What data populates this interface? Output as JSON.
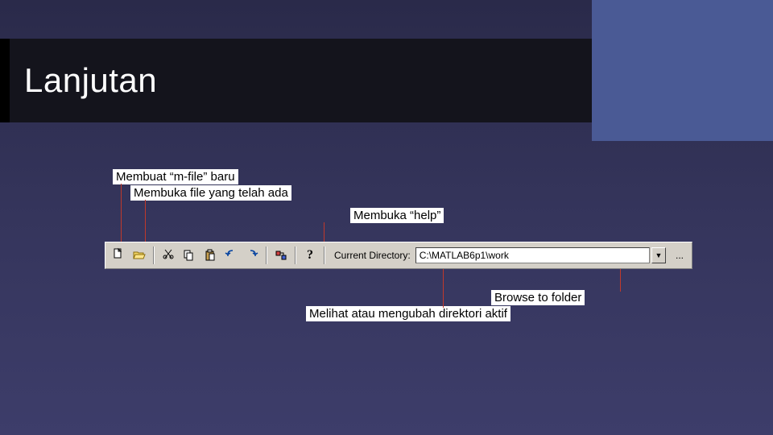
{
  "title": "Lanjutan",
  "annotations": {
    "new_mfile": "Membuat “m-file” baru",
    "open_file": "Membuka file yang telah ada",
    "open_help": "Membuka “help”",
    "browse_folder": "Browse to folder",
    "change_dir": "Melihat atau mengubah direktori aktif"
  },
  "toolbar": {
    "current_dir_label": "Current Directory:",
    "current_dir_value": "C:\\MATLAB6p1\\work",
    "help_glyph": "?",
    "browse_glyph": "..."
  }
}
